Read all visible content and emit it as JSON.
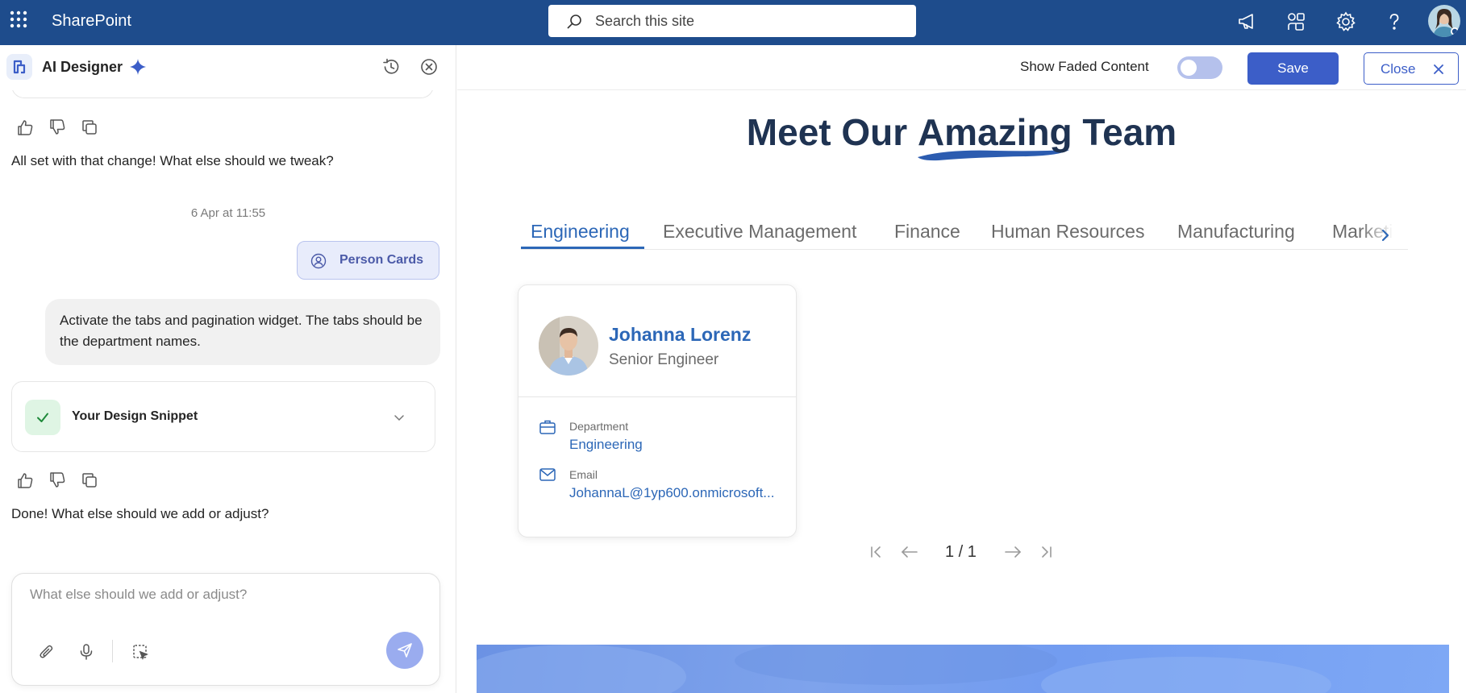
{
  "app": {
    "name": "SharePoint"
  },
  "search": {
    "placeholder": "Search this site"
  },
  "left_panel": {
    "title": "AI Designer",
    "messages": {
      "assistant_1": "All set with that change! What else should we tweak?",
      "timestamp": "6 Apr at 11:55",
      "context_chip": "Person Cards",
      "user_1": "Activate the tabs and pagination widget. The tabs should be the department names.",
      "snippet_label": "Your Design Snippet",
      "assistant_2": "Done! What else should we add or adjust?"
    },
    "composer": {
      "placeholder": "What else should we add or adjust?"
    }
  },
  "toolbar": {
    "fade_label": "Show Faded Content",
    "fade_on": false,
    "save_label": "Save",
    "close_label": "Close"
  },
  "canvas": {
    "title_before": "Meet Our",
    "title_highlight": "Amazing",
    "title_after": "Team",
    "tabs": [
      {
        "label": "Engineering",
        "active": true
      },
      {
        "label": "Executive Management",
        "active": false
      },
      {
        "label": "Finance",
        "active": false
      },
      {
        "label": "Human Resources",
        "active": false
      },
      {
        "label": "Manufacturing",
        "active": false
      },
      {
        "label": "Marketing",
        "active": false
      }
    ],
    "person": {
      "name": "Johanna Lorenz",
      "role": "Senior Engineer",
      "department_label": "Department",
      "department": "Engineering",
      "email_label": "Email",
      "email": "JohannaL@1yp600.onmicrosoft..."
    },
    "pagination": {
      "label": "1 / 1"
    }
  },
  "colors": {
    "suite_bar": "#1e4c8c",
    "accent": "#3c5ec8",
    "link": "#2c67b7",
    "title": "#1f3352"
  }
}
